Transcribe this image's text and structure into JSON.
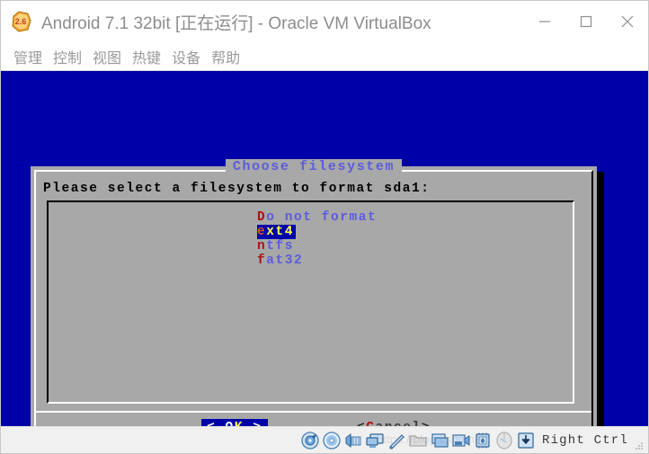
{
  "window": {
    "title": "Android 7.1 32bit [正在运行] - Oracle VM VirtualBox",
    "icon_name": "virtualbox-vm-icon",
    "icon_label": "2.6",
    "controls": [
      {
        "name": "minimize-button",
        "label": "—"
      },
      {
        "name": "maximize-button",
        "label": "□"
      },
      {
        "name": "close-button",
        "label": "✕"
      }
    ]
  },
  "menu_bar": {
    "items": [
      {
        "label": "管理"
      },
      {
        "label": "控制"
      },
      {
        "label": "视图"
      },
      {
        "label": "热键"
      },
      {
        "label": "设备"
      },
      {
        "label": "帮助"
      }
    ]
  },
  "vm_screen": {
    "background_color": "#0000a8"
  },
  "dialog": {
    "title": "Choose filesystem",
    "prompt": "Please select a filesystem to format sda1:",
    "list": {
      "items": [
        {
          "hot": "D",
          "rest": "o not format",
          "selected": false
        },
        {
          "hot": "e",
          "rest": "xt4",
          "selected": true
        },
        {
          "hot": "n",
          "rest": "tfs",
          "selected": false
        },
        {
          "hot": "f",
          "rest": "at32",
          "selected": false
        }
      ]
    },
    "buttons": {
      "ok": {
        "left_bracket": "<",
        "hot": "O",
        "rest": "K",
        "right_bracket": ">",
        "focused": true
      },
      "cancel": {
        "left_bracket": "<",
        "hot": "C",
        "rest": "ancel",
        "right_bracket": ">",
        "focused": false
      }
    },
    "colors": {
      "background": "#a8a8a8",
      "title_text": "#5c5cde",
      "prompt_text": "#000000",
      "item_hot": "#b01010",
      "item_rest": "#5c5cde",
      "selected_bg": "#0000a8",
      "selected_hot": "#d06000",
      "selected_rest": "#ffff4d"
    }
  },
  "status_bar": {
    "icons": [
      {
        "name": "hard-disk-icon"
      },
      {
        "name": "optical-disk-icon"
      },
      {
        "name": "network-icon"
      },
      {
        "name": "display-icon"
      },
      {
        "name": "usb-icon"
      },
      {
        "name": "folder-icon"
      },
      {
        "name": "shared-folders-icon"
      },
      {
        "name": "video-capture-icon"
      },
      {
        "name": "cpu-icon"
      },
      {
        "name": "mouse-icon"
      },
      {
        "name": "keyboard-capture-icon"
      }
    ],
    "host_key": "Right Ctrl",
    "watermark": "https://blog.csdn.net/"
  }
}
